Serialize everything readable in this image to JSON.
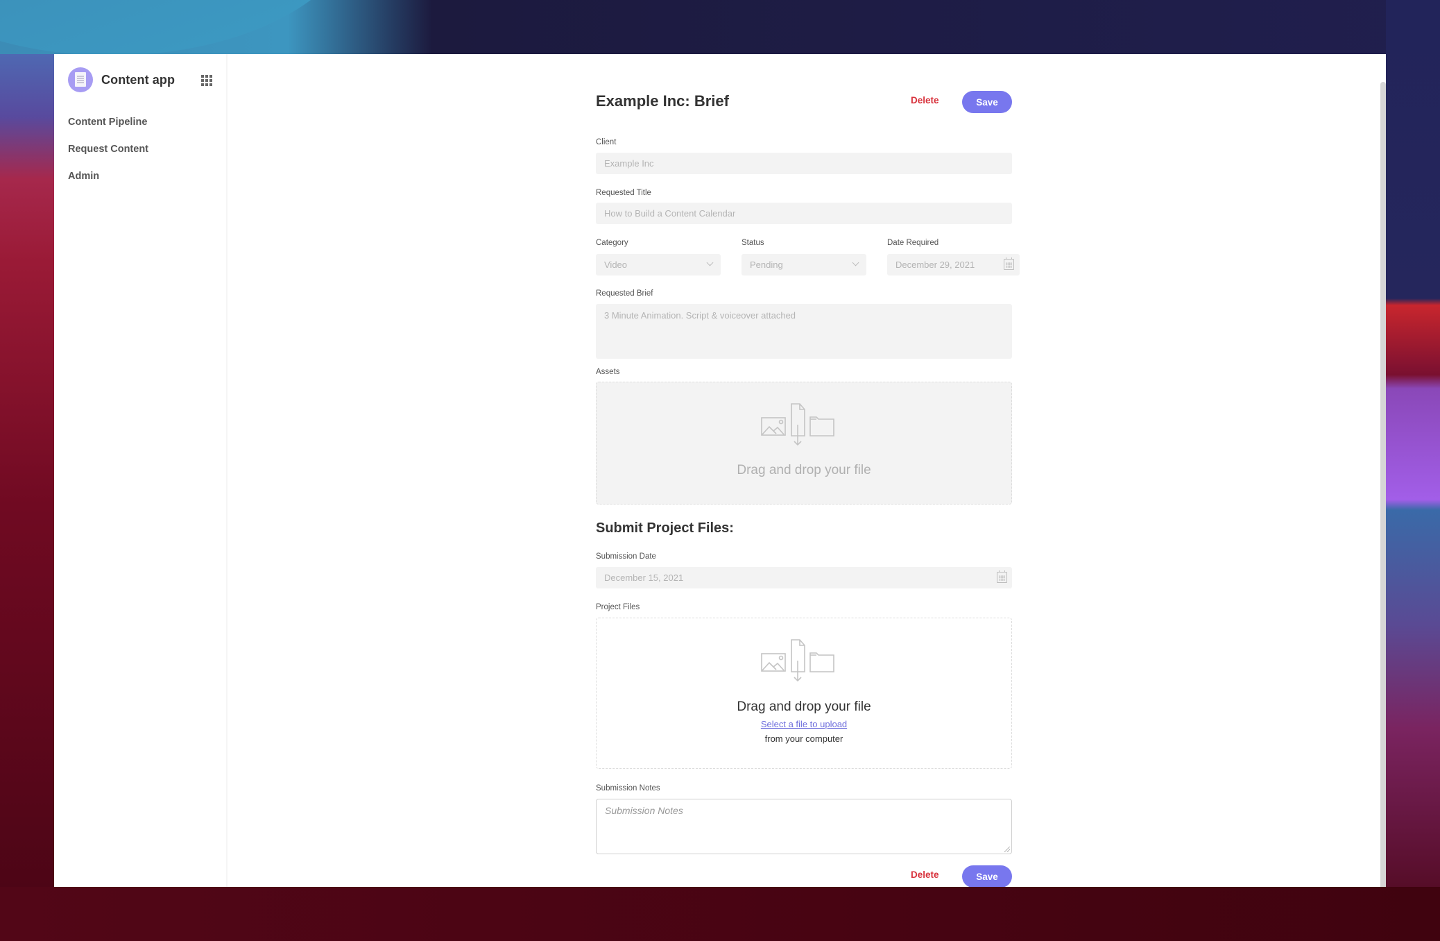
{
  "sidebar": {
    "app_name": "Content app",
    "logo_icon": "document-icon",
    "apps_icon": "grid-icon",
    "nav": [
      {
        "label": "Content Pipeline"
      },
      {
        "label": "Request Content"
      },
      {
        "label": "Admin"
      }
    ]
  },
  "header": {
    "title": "Example Inc: Brief",
    "delete_label": "Delete",
    "save_label": "Save"
  },
  "form": {
    "client": {
      "label": "Client",
      "value": "Example Inc"
    },
    "requested_title": {
      "label": "Requested Title",
      "value": "How to Build a Content Calendar"
    },
    "category": {
      "label": "Category",
      "value": "Video"
    },
    "status": {
      "label": "Status",
      "value": "Pending"
    },
    "date_required": {
      "label": "Date Required",
      "value": "December 29, 2021"
    },
    "requested_brief": {
      "label": "Requested Brief",
      "value": "3 Minute Animation. Script & voiceover attached"
    },
    "assets": {
      "label": "Assets",
      "drop_text": "Drag and drop your file"
    }
  },
  "submission": {
    "section_title": "Submit Project Files:",
    "submission_date": {
      "label": "Submission Date",
      "value": "December 15, 2021"
    },
    "project_files": {
      "label": "Project Files",
      "drop_text": "Drag and drop your file",
      "select_link": "Select a file to upload",
      "sub_text": "from your computer"
    },
    "notes": {
      "label": "Submission Notes",
      "placeholder": "Submission Notes"
    }
  },
  "footer": {
    "delete_label": "Delete",
    "save_label": "Save"
  },
  "colors": {
    "accent": "#7877ee",
    "danger": "#d8323c",
    "link": "#6c6cdc",
    "logo": "#a79cf3"
  }
}
